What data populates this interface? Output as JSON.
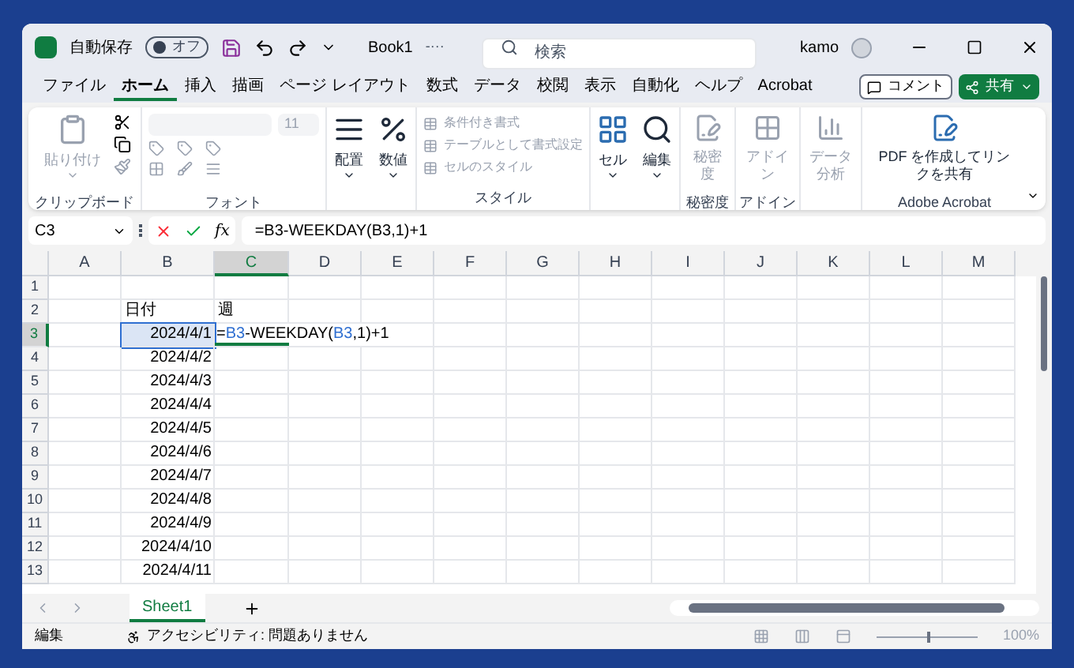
{
  "title_bar": {
    "autosave_label": "自動保存",
    "autosave": {
      "label": "オフ",
      "on": false
    },
    "title": "Book1",
    "title_suffix": "-···",
    "search": {
      "placeholder": "検索"
    },
    "user": "kamo"
  },
  "menu_tabs": [
    {
      "label": "ファイル",
      "selected": false
    },
    {
      "label": "ホーム",
      "selected": true
    },
    {
      "label": "挿入",
      "selected": false
    },
    {
      "label": "描画",
      "selected": false
    },
    {
      "label": "ページ レイアウト",
      "selected": false
    },
    {
      "label": "数式",
      "selected": false
    },
    {
      "label": "データ",
      "selected": false
    },
    {
      "label": "校閲",
      "selected": false
    },
    {
      "label": "表示",
      "selected": false
    },
    {
      "label": "自動化",
      "selected": false
    },
    {
      "label": "ヘルプ",
      "selected": false
    },
    {
      "label": "Acrobat",
      "selected": false
    }
  ],
  "comment_button": "コメント",
  "share_button": "共有",
  "ribbon": {
    "clipboard": {
      "paste": "貼り付け",
      "paste_disabled": true,
      "label": "クリップボード"
    },
    "font": {
      "size": "11",
      "label": "フォント"
    },
    "alignment": "配置",
    "number": "数値",
    "styles": {
      "items": [
        {
          "label": "条件付き書式",
          "disabled": true
        },
        {
          "label": "テーブルとして書式設定",
          "disabled": true
        },
        {
          "label": "セルのスタイル",
          "disabled": true
        }
      ],
      "label": "スタイル"
    },
    "cells": "セル",
    "editing": "編集",
    "sensitivity": {
      "button": "秘密度",
      "disabled": true,
      "label": "秘密度"
    },
    "addins": {
      "button": "アドイン",
      "disabled": true,
      "label": "アドイン"
    },
    "analysis": {
      "button": "データ分析",
      "disabled": true
    },
    "acrobat": {
      "button": "PDF を作成してリンクを共有",
      "label": "Adobe Acrobat"
    }
  },
  "formula_bar": {
    "name_box": "C3",
    "function_button": "fx",
    "formula": "=B3-WEEKDAY(B3,1)+1"
  },
  "columns": [
    {
      "label": "A",
      "selected": false
    },
    {
      "label": "B",
      "selected": false
    },
    {
      "label": "C",
      "selected": true
    },
    {
      "label": "D",
      "selected": false
    },
    {
      "label": "E",
      "selected": false
    },
    {
      "label": "F",
      "selected": false
    },
    {
      "label": "G",
      "selected": false
    },
    {
      "label": "H",
      "selected": false
    },
    {
      "label": "I",
      "selected": false
    },
    {
      "label": "J",
      "selected": false
    },
    {
      "label": "K",
      "selected": false
    },
    {
      "label": "L",
      "selected": false
    },
    {
      "label": "M",
      "selected": false
    }
  ],
  "rows": [
    {
      "label": "1",
      "selected": false,
      "cells": {}
    },
    {
      "label": "2",
      "selected": false,
      "cells": {
        "b": {
          "kind": "text",
          "text": "日付"
        },
        "c": {
          "kind": "text",
          "text": "週"
        }
      }
    },
    {
      "label": "3",
      "selected": true,
      "cells": {
        "b": {
          "kind": "date",
          "text": "2024/4/1",
          "highlighted": true
        },
        "c": {
          "kind": "formula",
          "parts": [
            {
              "text": "=",
              "ref": false
            },
            {
              "text": "B3",
              "ref": true
            },
            {
              "text": "-WEEKDAY(",
              "ref": false
            },
            {
              "text": "B3",
              "ref": true
            },
            {
              "text": ",1)+1",
              "ref": false
            }
          ]
        }
      }
    },
    {
      "label": "4",
      "selected": false,
      "cells": {
        "b": {
          "kind": "date",
          "text": "2024/4/2"
        }
      }
    },
    {
      "label": "5",
      "selected": false,
      "cells": {
        "b": {
          "kind": "date",
          "text": "2024/4/3"
        }
      }
    },
    {
      "label": "6",
      "selected": false,
      "cells": {
        "b": {
          "kind": "date",
          "text": "2024/4/4"
        }
      }
    },
    {
      "label": "7",
      "selected": false,
      "cells": {
        "b": {
          "kind": "date",
          "text": "2024/4/5"
        }
      }
    },
    {
      "label": "8",
      "selected": false,
      "cells": {
        "b": {
          "kind": "date",
          "text": "2024/4/6"
        }
      }
    },
    {
      "label": "9",
      "selected": false,
      "cells": {
        "b": {
          "kind": "date",
          "text": "2024/4/7"
        }
      }
    },
    {
      "label": "10",
      "selected": false,
      "cells": {
        "b": {
          "kind": "date",
          "text": "2024/4/8"
        }
      }
    },
    {
      "label": "11",
      "selected": false,
      "cells": {
        "b": {
          "kind": "date",
          "text": "2024/4/9"
        }
      }
    },
    {
      "label": "12",
      "selected": false,
      "cells": {
        "b": {
          "kind": "date",
          "text": "2024/4/10"
        }
      }
    },
    {
      "label": "13",
      "selected": false,
      "cells": {
        "b": {
          "kind": "date",
          "text": "2024/4/11"
        }
      }
    }
  ],
  "sheet_tabs": [
    {
      "label": "Sheet1",
      "selected": true
    }
  ],
  "status_bar": {
    "mode": "編集",
    "accessibility": "アクセシビリティ: 問題ありません",
    "zoom": {
      "level": 0.5,
      "reading": "100%"
    }
  }
}
